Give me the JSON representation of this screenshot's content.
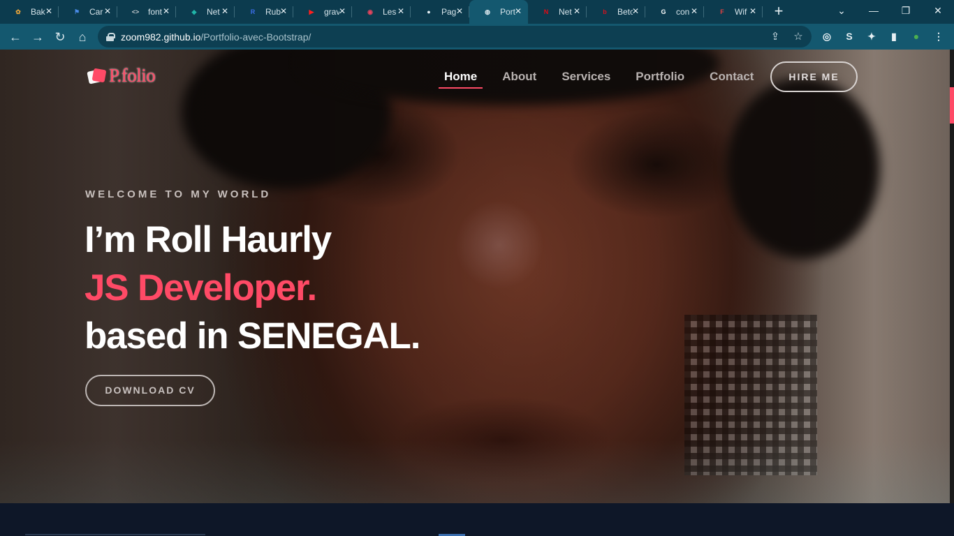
{
  "browser": {
    "tabs": [
      {
        "title": "Bak",
        "icon": "brand-icon",
        "color": "#e8a43a",
        "glyph": "✿",
        "active": false
      },
      {
        "title": "Car",
        "icon": "flag-icon",
        "color": "#4a8be8",
        "glyph": "⚑",
        "active": false
      },
      {
        "title": "font",
        "icon": "code-icon",
        "color": "#c0c8cc",
        "glyph": "<>",
        "active": false
      },
      {
        "title": "Net",
        "icon": "diamond-icon",
        "color": "#21b5a8",
        "glyph": "◆",
        "active": false
      },
      {
        "title": "Rub",
        "icon": "rubric-icon",
        "color": "#3b6ee8",
        "glyph": "R",
        "active": false
      },
      {
        "title": "grav",
        "icon": "youtube-icon",
        "color": "#ff1f1f",
        "glyph": "▶",
        "active": false
      },
      {
        "title": "Les",
        "icon": "recording-icon",
        "color": "#e8455e",
        "glyph": "◉",
        "active": false
      },
      {
        "title": "Pag",
        "icon": "github-icon",
        "color": "#e6eef2",
        "glyph": "●",
        "active": false
      },
      {
        "title": "Port",
        "icon": "globe-icon",
        "color": "#dce8ee",
        "glyph": "◍",
        "active": true
      },
      {
        "title": "Net",
        "icon": "netflix-icon",
        "color": "#e50914",
        "glyph": "N",
        "active": false
      },
      {
        "title": "Betc",
        "icon": "betclic-icon",
        "color": "#d4121e",
        "glyph": "b",
        "active": false
      },
      {
        "title": "con",
        "icon": "google-icon",
        "color": "#ffffff",
        "glyph": "G",
        "active": false
      },
      {
        "title": "Wif",
        "icon": "wf-icon",
        "color": "#e64040",
        "glyph": "F",
        "active": false
      }
    ],
    "close_glyph": "✕",
    "new_tab_glyph": "+",
    "window_controls": {
      "chevron": "⌄",
      "minimize": "—",
      "restore": "❐",
      "close": "✕"
    },
    "toolbar": {
      "back": "←",
      "forward": "→",
      "reload": "↻",
      "home": "⌂"
    },
    "url_host": "zoom982.github.io",
    "url_path": "/Portfolio-avec-Bootstrap/",
    "omnibox_icons": {
      "share": "⇪",
      "bookmark": "☆"
    },
    "extensions": {
      "ext1": "◎",
      "ext2": "S",
      "puzzle": "✦",
      "sidepanel": "▮",
      "profile": "●"
    }
  },
  "site": {
    "logo": "P.folio",
    "nav": [
      {
        "label": "Home",
        "active": true
      },
      {
        "label": "About",
        "active": false
      },
      {
        "label": "Services",
        "active": false
      },
      {
        "label": "Portfolio",
        "active": false
      },
      {
        "label": "Contact",
        "active": false
      }
    ],
    "hire_button": "HIRE ME",
    "welcome": "WELCOME TO MY WORLD",
    "headline_1": "I’m Roll Haurly",
    "headline_2": "JS Developer.",
    "headline_3": "based in SENEGAL.",
    "cv_button": "DOWNLOAD CV",
    "accent_color": "#ff4a66"
  }
}
